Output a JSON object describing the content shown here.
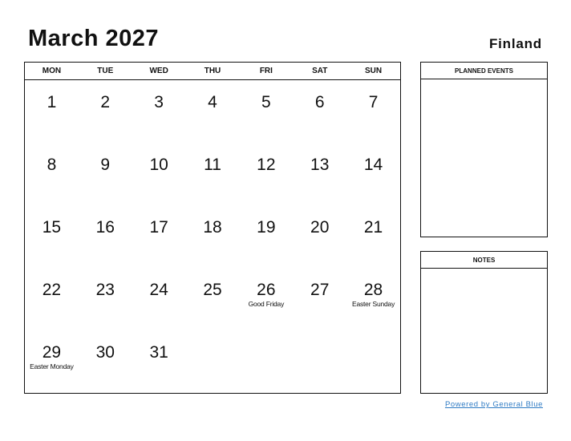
{
  "header": {
    "title": "March 2027",
    "country": "Finland"
  },
  "calendar": {
    "weekdays": [
      "MON",
      "TUE",
      "WED",
      "THU",
      "FRI",
      "SAT",
      "SUN"
    ],
    "weeks": [
      [
        {
          "day": "1",
          "holiday": ""
        },
        {
          "day": "2",
          "holiday": ""
        },
        {
          "day": "3",
          "holiday": ""
        },
        {
          "day": "4",
          "holiday": ""
        },
        {
          "day": "5",
          "holiday": ""
        },
        {
          "day": "6",
          "holiday": ""
        },
        {
          "day": "7",
          "holiday": ""
        }
      ],
      [
        {
          "day": "8",
          "holiday": ""
        },
        {
          "day": "9",
          "holiday": ""
        },
        {
          "day": "10",
          "holiday": ""
        },
        {
          "day": "11",
          "holiday": ""
        },
        {
          "day": "12",
          "holiday": ""
        },
        {
          "day": "13",
          "holiday": ""
        },
        {
          "day": "14",
          "holiday": ""
        }
      ],
      [
        {
          "day": "15",
          "holiday": ""
        },
        {
          "day": "16",
          "holiday": ""
        },
        {
          "day": "17",
          "holiday": ""
        },
        {
          "day": "18",
          "holiday": ""
        },
        {
          "day": "19",
          "holiday": ""
        },
        {
          "day": "20",
          "holiday": ""
        },
        {
          "day": "21",
          "holiday": ""
        }
      ],
      [
        {
          "day": "22",
          "holiday": ""
        },
        {
          "day": "23",
          "holiday": ""
        },
        {
          "day": "24",
          "holiday": ""
        },
        {
          "day": "25",
          "holiday": ""
        },
        {
          "day": "26",
          "holiday": "Good Friday"
        },
        {
          "day": "27",
          "holiday": ""
        },
        {
          "day": "28",
          "holiday": "Easter Sunday"
        }
      ],
      [
        {
          "day": "29",
          "holiday": "Easter Monday"
        },
        {
          "day": "30",
          "holiday": ""
        },
        {
          "day": "31",
          "holiday": ""
        },
        {
          "day": "",
          "holiday": ""
        },
        {
          "day": "",
          "holiday": ""
        },
        {
          "day": "",
          "holiday": ""
        },
        {
          "day": "",
          "holiday": ""
        }
      ]
    ]
  },
  "panels": {
    "planned_events": "PLANNED EVENTS",
    "notes": "NOTES"
  },
  "footer": {
    "powered_by": "Powered by General Blue",
    "link_color": "#2f7bc4"
  }
}
